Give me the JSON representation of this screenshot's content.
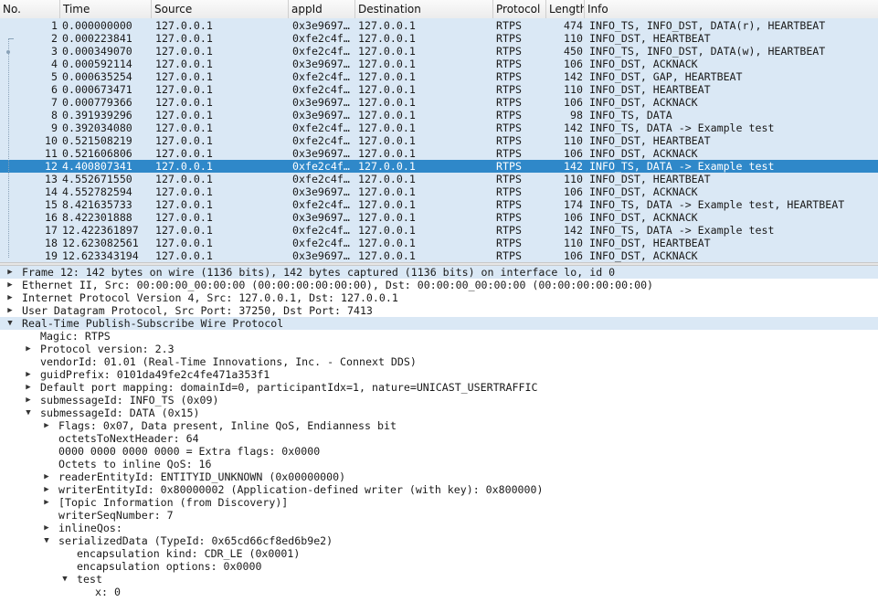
{
  "columns": [
    "No.",
    "Time",
    "Source",
    "appId",
    "Destination",
    "Protocol",
    "Length",
    "Info"
  ],
  "packets": [
    {
      "no": "1",
      "time": "0.000000000",
      "src": "127.0.0.1",
      "app": "0x3e9697…",
      "dst": "127.0.0.1",
      "proto": "RTPS",
      "len": "474",
      "info": "INFO_TS, INFO_DST, DATA(r), HEARTBEAT",
      "selected": false
    },
    {
      "no": "2",
      "time": "0.000223841",
      "src": "127.0.0.1",
      "app": "0xfe2c4f…",
      "dst": "127.0.0.1",
      "proto": "RTPS",
      "len": "110",
      "info": "INFO_DST, HEARTBEAT",
      "selected": false
    },
    {
      "no": "3",
      "time": "0.000349070",
      "src": "127.0.0.1",
      "app": "0xfe2c4f…",
      "dst": "127.0.0.1",
      "proto": "RTPS",
      "len": "450",
      "info": "INFO_TS, INFO_DST, DATA(w), HEARTBEAT",
      "selected": false
    },
    {
      "no": "4",
      "time": "0.000592114",
      "src": "127.0.0.1",
      "app": "0x3e9697…",
      "dst": "127.0.0.1",
      "proto": "RTPS",
      "len": "106",
      "info": "INFO_DST, ACKNACK",
      "selected": false
    },
    {
      "no": "5",
      "time": "0.000635254",
      "src": "127.0.0.1",
      "app": "0xfe2c4f…",
      "dst": "127.0.0.1",
      "proto": "RTPS",
      "len": "142",
      "info": "INFO_DST, GAP, HEARTBEAT",
      "selected": false
    },
    {
      "no": "6",
      "time": "0.000673471",
      "src": "127.0.0.1",
      "app": "0xfe2c4f…",
      "dst": "127.0.0.1",
      "proto": "RTPS",
      "len": "110",
      "info": "INFO_DST, HEARTBEAT",
      "selected": false
    },
    {
      "no": "7",
      "time": "0.000779366",
      "src": "127.0.0.1",
      "app": "0x3e9697…",
      "dst": "127.0.0.1",
      "proto": "RTPS",
      "len": "106",
      "info": "INFO_DST, ACKNACK",
      "selected": false
    },
    {
      "no": "8",
      "time": "0.391939296",
      "src": "127.0.0.1",
      "app": "0x3e9697…",
      "dst": "127.0.0.1",
      "proto": "RTPS",
      "len": "98",
      "info": "INFO_TS, DATA",
      "selected": false
    },
    {
      "no": "9",
      "time": "0.392034080",
      "src": "127.0.0.1",
      "app": "0xfe2c4f…",
      "dst": "127.0.0.1",
      "proto": "RTPS",
      "len": "142",
      "info": "INFO_TS, DATA -> Example test",
      "selected": false
    },
    {
      "no": "10",
      "time": "0.521508219",
      "src": "127.0.0.1",
      "app": "0xfe2c4f…",
      "dst": "127.0.0.1",
      "proto": "RTPS",
      "len": "110",
      "info": "INFO_DST, HEARTBEAT",
      "selected": false
    },
    {
      "no": "11",
      "time": "0.521606806",
      "src": "127.0.0.1",
      "app": "0x3e9697…",
      "dst": "127.0.0.1",
      "proto": "RTPS",
      "len": "106",
      "info": "INFO_DST, ACKNACK",
      "selected": false
    },
    {
      "no": "12",
      "time": "4.400807341",
      "src": "127.0.0.1",
      "app": "0xfe2c4f…",
      "dst": "127.0.0.1",
      "proto": "RTPS",
      "len": "142",
      "info": "INFO_TS, DATA -> Example test",
      "selected": true
    },
    {
      "no": "13",
      "time": "4.552671550",
      "src": "127.0.0.1",
      "app": "0xfe2c4f…",
      "dst": "127.0.0.1",
      "proto": "RTPS",
      "len": "110",
      "info": "INFO_DST, HEARTBEAT",
      "selected": false
    },
    {
      "no": "14",
      "time": "4.552782594",
      "src": "127.0.0.1",
      "app": "0x3e9697…",
      "dst": "127.0.0.1",
      "proto": "RTPS",
      "len": "106",
      "info": "INFO_DST, ACKNACK",
      "selected": false
    },
    {
      "no": "15",
      "time": "8.421635733",
      "src": "127.0.0.1",
      "app": "0xfe2c4f…",
      "dst": "127.0.0.1",
      "proto": "RTPS",
      "len": "174",
      "info": "INFO_TS, DATA -> Example test, HEARTBEAT",
      "selected": false
    },
    {
      "no": "16",
      "time": "8.422301888",
      "src": "127.0.0.1",
      "app": "0x3e9697…",
      "dst": "127.0.0.1",
      "proto": "RTPS",
      "len": "106",
      "info": "INFO_DST, ACKNACK",
      "selected": false
    },
    {
      "no": "17",
      "time": "12.422361897",
      "src": "127.0.0.1",
      "app": "0xfe2c4f…",
      "dst": "127.0.0.1",
      "proto": "RTPS",
      "len": "142",
      "info": "INFO_TS, DATA -> Example test",
      "selected": false
    },
    {
      "no": "18",
      "time": "12.623082561",
      "src": "127.0.0.1",
      "app": "0xfe2c4f…",
      "dst": "127.0.0.1",
      "proto": "RTPS",
      "len": "110",
      "info": "INFO_DST, HEARTBEAT",
      "selected": false
    },
    {
      "no": "19",
      "time": "12.623343194",
      "src": "127.0.0.1",
      "app": "0x3e9697…",
      "dst": "127.0.0.1",
      "proto": "RTPS",
      "len": "106",
      "info": "INFO_DST, ACKNACK",
      "selected": false
    }
  ],
  "details": [
    {
      "level": 0,
      "state": "collapsed",
      "text": "Frame 12: 142 bytes on wire (1136 bits), 142 bytes captured (1136 bits) on interface lo, id 0",
      "hl": true
    },
    {
      "level": 0,
      "state": "collapsed",
      "text": "Ethernet II, Src: 00:00:00_00:00:00 (00:00:00:00:00:00), Dst: 00:00:00_00:00:00 (00:00:00:00:00:00)",
      "hl": false
    },
    {
      "level": 0,
      "state": "collapsed",
      "text": "Internet Protocol Version 4, Src: 127.0.0.1, Dst: 127.0.0.1",
      "hl": false
    },
    {
      "level": 0,
      "state": "collapsed",
      "text": "User Datagram Protocol, Src Port: 37250, Dst Port: 7413",
      "hl": false
    },
    {
      "level": 0,
      "state": "expanded",
      "text": "Real-Time Publish-Subscribe Wire Protocol",
      "hl": true
    },
    {
      "level": 1,
      "state": "leaf",
      "text": "Magic: RTPS",
      "hl": false
    },
    {
      "level": 1,
      "state": "collapsed",
      "text": "Protocol version: 2.3",
      "hl": false
    },
    {
      "level": 1,
      "state": "leaf",
      "text": "vendorId: 01.01 (Real-Time Innovations, Inc. - Connext DDS)",
      "hl": false
    },
    {
      "level": 1,
      "state": "collapsed",
      "text": "guidPrefix: 0101da49fe2c4fe471a353f1",
      "hl": false
    },
    {
      "level": 1,
      "state": "collapsed",
      "text": "Default port mapping: domainId=0, participantIdx=1, nature=UNICAST_USERTRAFFIC",
      "hl": false
    },
    {
      "level": 1,
      "state": "collapsed",
      "text": "submessageId: INFO_TS (0x09)",
      "hl": false
    },
    {
      "level": 1,
      "state": "expanded",
      "text": "submessageId: DATA (0x15)",
      "hl": false
    },
    {
      "level": 2,
      "state": "collapsed",
      "text": "Flags: 0x07, Data present, Inline QoS, Endianness bit",
      "hl": false
    },
    {
      "level": 2,
      "state": "leaf",
      "text": "octetsToNextHeader: 64",
      "hl": false
    },
    {
      "level": 2,
      "state": "leaf",
      "text": "0000 0000 0000 0000 = Extra flags: 0x0000",
      "hl": false
    },
    {
      "level": 2,
      "state": "leaf",
      "text": "Octets to inline QoS: 16",
      "hl": false
    },
    {
      "level": 2,
      "state": "collapsed",
      "text": "readerEntityId: ENTITYID_UNKNOWN (0x00000000)",
      "hl": false
    },
    {
      "level": 2,
      "state": "collapsed",
      "text": "writerEntityId: 0x80000002 (Application-defined writer (with key): 0x800000)",
      "hl": false
    },
    {
      "level": 2,
      "state": "collapsed",
      "text": "[Topic Information (from Discovery)]",
      "hl": false
    },
    {
      "level": 2,
      "state": "leaf",
      "text": "writerSeqNumber: 7",
      "hl": false
    },
    {
      "level": 2,
      "state": "collapsed",
      "text": "inlineQos:",
      "hl": false
    },
    {
      "level": 2,
      "state": "expanded",
      "text": "serializedData (TypeId: 0x65cd66cf8ed6b9e2)",
      "hl": false
    },
    {
      "level": 3,
      "state": "leaf",
      "text": "encapsulation kind: CDR_LE (0x0001)",
      "hl": false
    },
    {
      "level": 3,
      "state": "leaf",
      "text": "encapsulation options: 0x0000",
      "hl": false
    },
    {
      "level": 3,
      "state": "expanded",
      "text": "test",
      "hl": false
    },
    {
      "level": 4,
      "state": "leaf",
      "text": "x: 0",
      "hl": false
    }
  ]
}
